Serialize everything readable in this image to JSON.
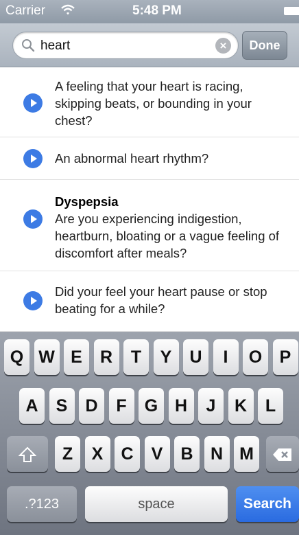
{
  "status_bar": {
    "carrier": "Carrier",
    "time": "5:48 PM"
  },
  "search": {
    "query": "heart",
    "done_label": "Done"
  },
  "results": [
    {
      "title": "",
      "text": "A feeling that your heart is racing, skipping beats, or bounding in your chest?"
    },
    {
      "title": "",
      "text": "An abnormal heart rhythm?"
    },
    {
      "title": "Dyspepsia",
      "text": "Are you experiencing indigestion, heartburn, bloating or a vague feeling of discomfort after meals?"
    },
    {
      "title": "",
      "text": "Did your feel your heart pause or stop beating for a while?"
    }
  ],
  "keyboard": {
    "row1": [
      "Q",
      "W",
      "E",
      "R",
      "T",
      "Y",
      "U",
      "I",
      "O",
      "P"
    ],
    "row2": [
      "A",
      "S",
      "D",
      "F",
      "G",
      "H",
      "J",
      "K",
      "L"
    ],
    "row3": [
      "Z",
      "X",
      "C",
      "V",
      "B",
      "N",
      "M"
    ],
    "numbers_label": ".?123",
    "space_label": "space",
    "search_label": "Search",
    "shift_icon": "shift-icon",
    "delete_icon": "delete-icon"
  },
  "colors": {
    "accent": "#3b7be8",
    "search_key": "#2f72e6"
  }
}
